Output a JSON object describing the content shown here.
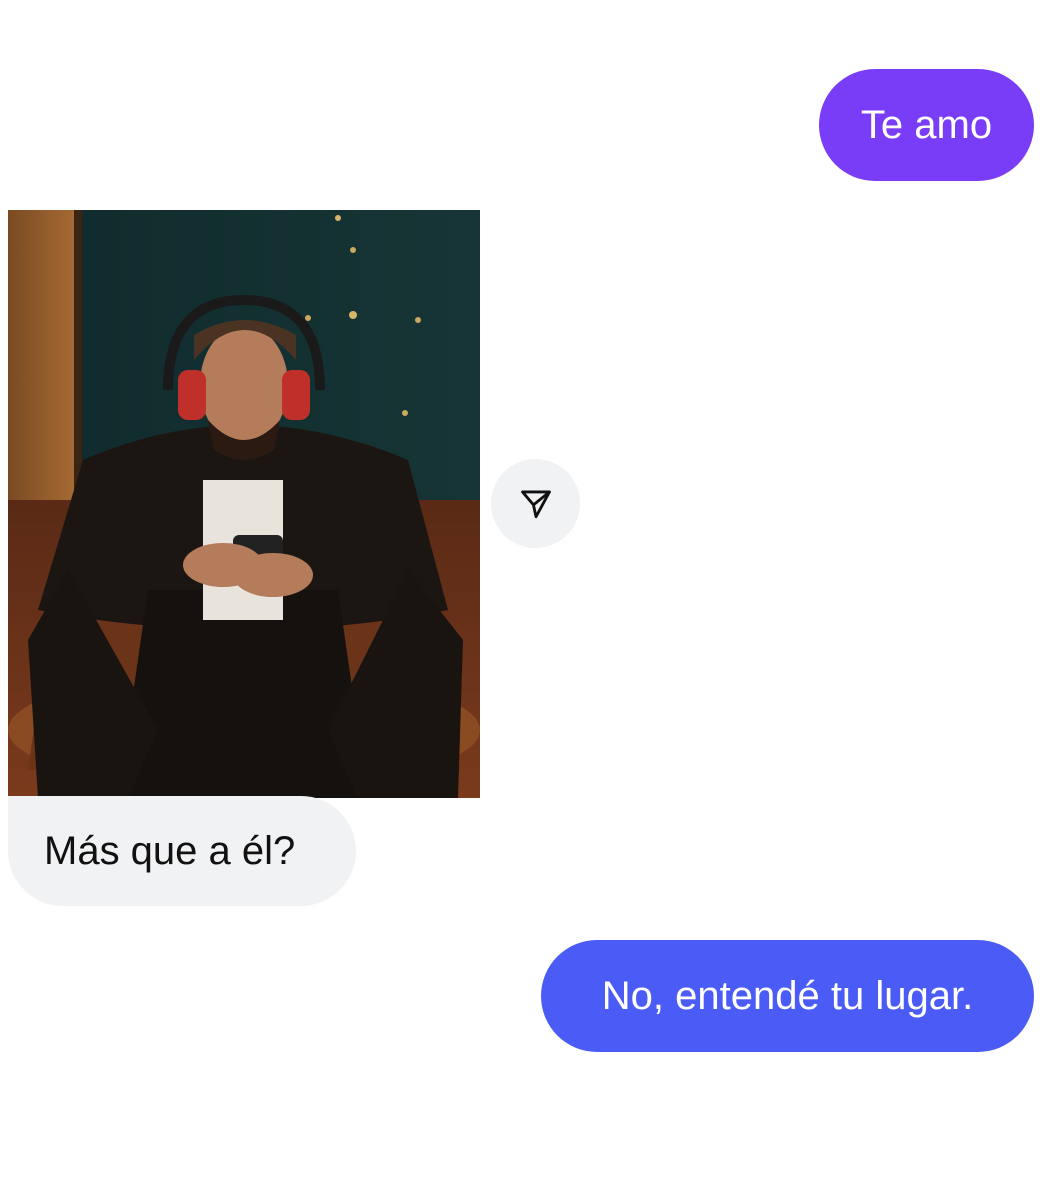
{
  "colors": {
    "outgoing_first": "#7a3df7",
    "outgoing_second": "#4b5cf6",
    "incoming_bg": "#f1f2f4",
    "incoming_text": "#111111"
  },
  "messages": [
    {
      "direction": "outgoing",
      "text": "Te amo"
    },
    {
      "direction": "incoming",
      "type": "image",
      "alt": ""
    },
    {
      "direction": "incoming",
      "text": "Más que a él?"
    },
    {
      "direction": "outgoing",
      "text": "No, entendé tu lugar."
    }
  ],
  "icons": {
    "share": "send-paper-plane-icon"
  }
}
